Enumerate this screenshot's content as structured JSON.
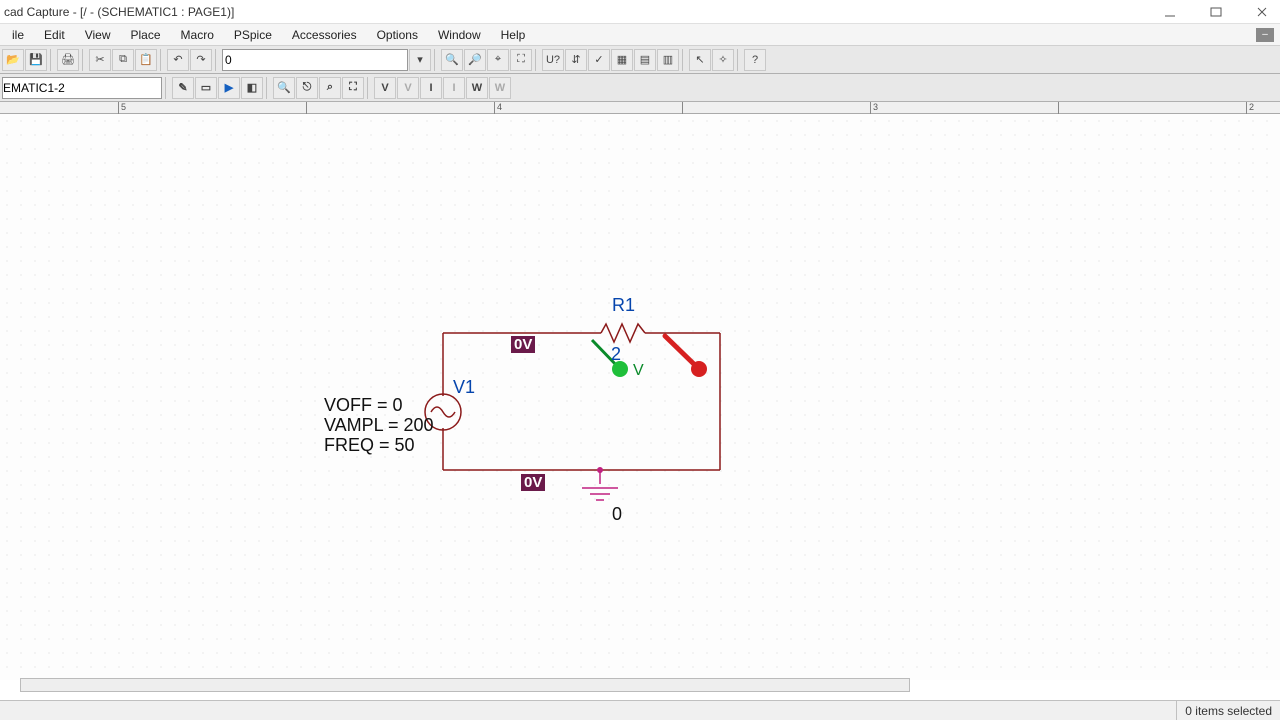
{
  "window": {
    "title": "cad Capture - [/ - (SCHEMATIC1 : PAGE1)]"
  },
  "menu": {
    "file": "ile",
    "edit": "Edit",
    "view": "View",
    "place": "Place",
    "macro": "Macro",
    "pspice": "PSpice",
    "accessories": "Accessories",
    "options": "Options",
    "window": "Window",
    "help": "Help"
  },
  "toolbar": {
    "part_search_value": "0"
  },
  "toolbar2": {
    "sheet_value": "EMATIC1-2",
    "marker_v": "V",
    "marker_i": "I",
    "marker_w": "W"
  },
  "ruler": {
    "ticks": [
      {
        "pos": 118,
        "label": "5"
      },
      {
        "pos": 494,
        "label": "4"
      },
      {
        "pos": 682,
        "label": ""
      },
      {
        "pos": 870,
        "label": "3"
      },
      {
        "pos": 1058,
        "label": ""
      },
      {
        "pos": 1246,
        "label": "2"
      }
    ]
  },
  "schematic": {
    "resistor": {
      "ref": "R1",
      "value": "2"
    },
    "vsource": {
      "ref": "V1",
      "voff": "VOFF = 0",
      "vampl": "VAMPL = 200",
      "freq": "FREQ = 50"
    },
    "net_top": "0V",
    "net_bottom": "0V",
    "probe_v": "V",
    "ground_label": "0"
  },
  "statusbar": {
    "selection": "0 items selected"
  }
}
